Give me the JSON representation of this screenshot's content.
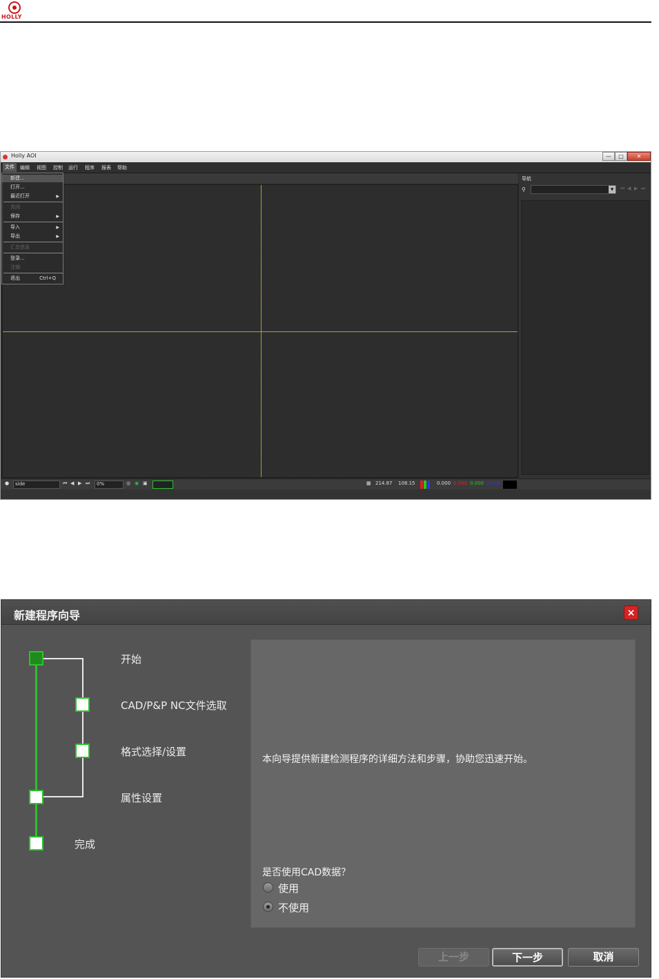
{
  "doc": {
    "logo_text": "HOLLY"
  },
  "app": {
    "title": "Holly AOI",
    "window_buttons": {
      "minimize": "—",
      "maximize": "□",
      "close": "✕"
    },
    "menubar": [
      "文件",
      "编辑",
      "视图",
      "控制",
      "运行",
      "程序",
      "报表",
      "帮助"
    ],
    "file_menu": {
      "new": "新建...",
      "open": "打开...",
      "recent": "最近打开",
      "close": "关闭",
      "save": "保存",
      "import": "导入",
      "export": "导出",
      "disabled_item": "汇总信息",
      "login": "登录...",
      "logout": "注销",
      "exit": "退出",
      "exit_shortcut": "Ctrl+Q"
    },
    "nav": {
      "title": "导航"
    },
    "status": {
      "view": "side",
      "zoom": "0%",
      "coord_x": "214.87",
      "coord_y": "108.15",
      "rgb": [
        "0.000",
        "0.000",
        "0.000",
        "0.000"
      ]
    },
    "colors": {
      "crosshair": "#b8a21b",
      "background": "#2a2a2a"
    }
  },
  "wizard": {
    "title": "新建程序向导",
    "close_icon": "×",
    "steps": [
      "开始",
      "CAD/P&P NC文件选取",
      "格式选择/设置",
      "属性设置",
      "完成"
    ],
    "description": "本向导提供新建检测程序的详细方法和步骤，协助您迅速开始。",
    "question": "是否使用CAD数据？",
    "options": [
      {
        "label": "使用",
        "selected": false
      },
      {
        "label": "不使用",
        "selected": true
      }
    ],
    "buttons": {
      "prev": "上一步",
      "next": "下一步",
      "cancel": "取消"
    },
    "colors": {
      "track": "#2cc22c",
      "current_step": "#1f8a1f"
    }
  }
}
